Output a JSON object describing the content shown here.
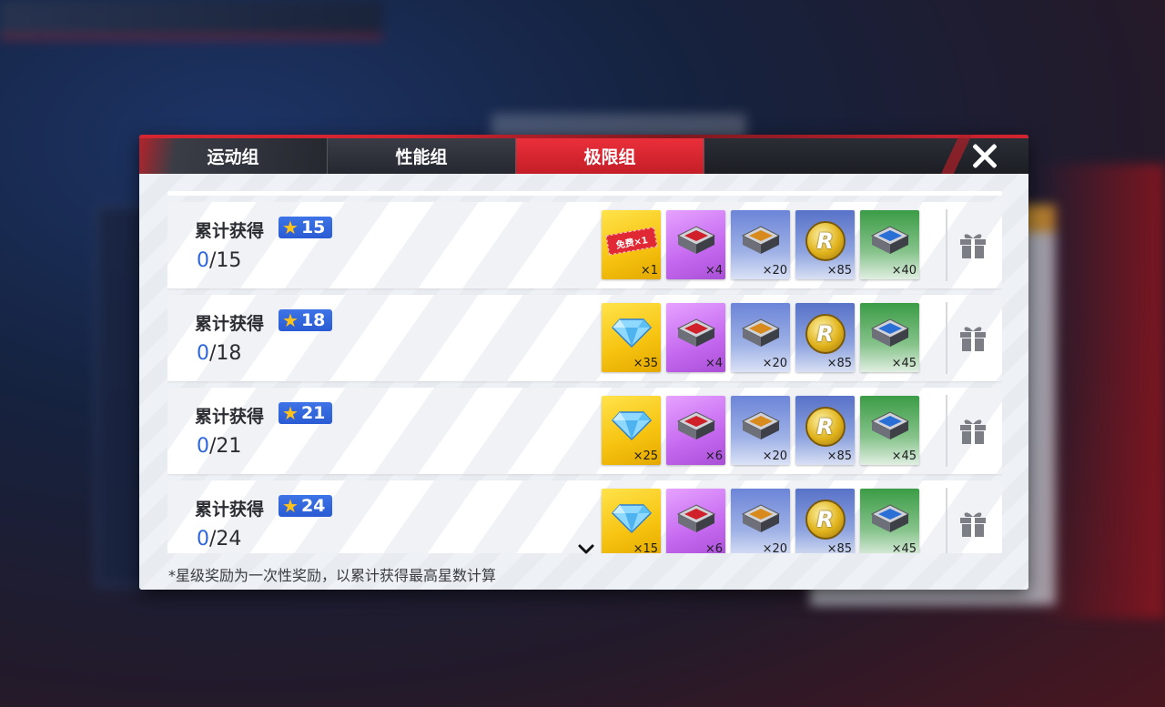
{
  "tabs": [
    {
      "label": "运动组",
      "active": false
    },
    {
      "label": "性能组",
      "active": false
    },
    {
      "label": "极限组",
      "active": true
    }
  ],
  "rows": [
    {
      "label": "累计获得",
      "stars": "15",
      "progress_current": "0",
      "progress_total": "/15",
      "rewards": [
        {
          "type": "ticket",
          "icon": "free-ticket-icon",
          "ticket_text": "免费×1",
          "qty": "×1",
          "bg": "gold"
        },
        {
          "type": "crate",
          "icon": "red-crate-icon",
          "qty": "×4",
          "bg": "purple"
        },
        {
          "type": "crate",
          "icon": "orange-crate-icon",
          "qty": "×20",
          "bg": "blue"
        },
        {
          "type": "coin",
          "icon": "gold-coin-icon",
          "qty": "×85",
          "bg": "blue2"
        },
        {
          "type": "crate",
          "icon": "blue-crate-icon",
          "qty": "×40",
          "bg": "green"
        }
      ]
    },
    {
      "label": "累计获得",
      "stars": "18",
      "progress_current": "0",
      "progress_total": "/18",
      "rewards": [
        {
          "type": "diamond",
          "icon": "diamond-icon",
          "qty": "×35",
          "bg": "gold"
        },
        {
          "type": "crate",
          "icon": "red-crate-icon",
          "qty": "×4",
          "bg": "purple"
        },
        {
          "type": "crate",
          "icon": "orange-crate-icon",
          "qty": "×20",
          "bg": "blue"
        },
        {
          "type": "coin",
          "icon": "gold-coin-icon",
          "qty": "×85",
          "bg": "blue2"
        },
        {
          "type": "crate",
          "icon": "blue-crate-icon",
          "qty": "×45",
          "bg": "green"
        }
      ]
    },
    {
      "label": "累计获得",
      "stars": "21",
      "progress_current": "0",
      "progress_total": "/21",
      "rewards": [
        {
          "type": "diamond",
          "icon": "diamond-icon",
          "qty": "×25",
          "bg": "gold"
        },
        {
          "type": "crate",
          "icon": "red-crate-icon",
          "qty": "×6",
          "bg": "purple"
        },
        {
          "type": "crate",
          "icon": "orange-crate-icon",
          "qty": "×20",
          "bg": "blue"
        },
        {
          "type": "coin",
          "icon": "gold-coin-icon",
          "qty": "×85",
          "bg": "blue2"
        },
        {
          "type": "crate",
          "icon": "blue-crate-icon",
          "qty": "×45",
          "bg": "green"
        }
      ]
    },
    {
      "label": "累计获得",
      "stars": "24",
      "progress_current": "0",
      "progress_total": "/24",
      "rewards": [
        {
          "type": "diamond",
          "icon": "diamond-icon",
          "qty": "×15",
          "bg": "gold"
        },
        {
          "type": "crate",
          "icon": "red-crate-icon",
          "qty": "×6",
          "bg": "purple"
        },
        {
          "type": "crate",
          "icon": "orange-crate-icon",
          "qty": "×20",
          "bg": "blue"
        },
        {
          "type": "coin",
          "icon": "gold-coin-icon",
          "qty": "×85",
          "bg": "blue2"
        },
        {
          "type": "crate",
          "icon": "blue-crate-icon",
          "qty": "×45",
          "bg": "green"
        }
      ]
    }
  ],
  "footnote": "*星级奖励为一次性奖励，以累计获得最高星数计算",
  "colors": {
    "accent_red": "#d42530",
    "star_badge_blue": "#2f66dc",
    "star_gold": "#ffc21a"
  }
}
